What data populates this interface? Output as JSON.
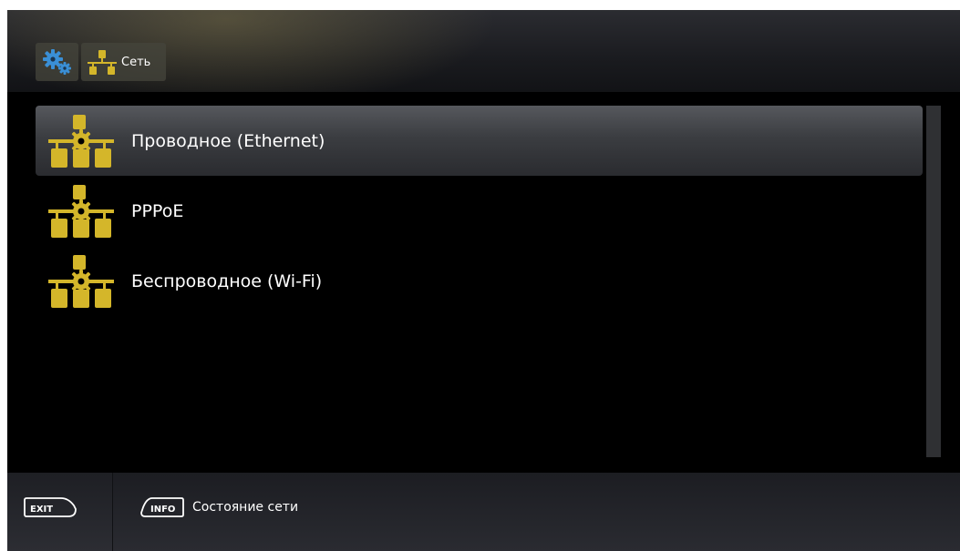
{
  "header": {
    "breadcrumbs": [
      {
        "icon": "gears-icon",
        "label": ""
      },
      {
        "icon": "network-icon",
        "label": "Сеть"
      }
    ]
  },
  "menu": {
    "selected_index": 0,
    "items": [
      {
        "icon": "network-settings-icon",
        "label": "Проводное (Ethernet)"
      },
      {
        "icon": "network-settings-icon",
        "label": "PPPoE"
      },
      {
        "icon": "network-settings-icon",
        "label": "Беспроводное (Wi-Fi)"
      }
    ]
  },
  "footer": {
    "exit_key": "EXIT",
    "info_key": "INFO",
    "info_label": "Состояние сети"
  },
  "colors": {
    "accent_yellow": "#d4b62a",
    "gear_blue": "#3a8fd6",
    "background": "#000000"
  }
}
